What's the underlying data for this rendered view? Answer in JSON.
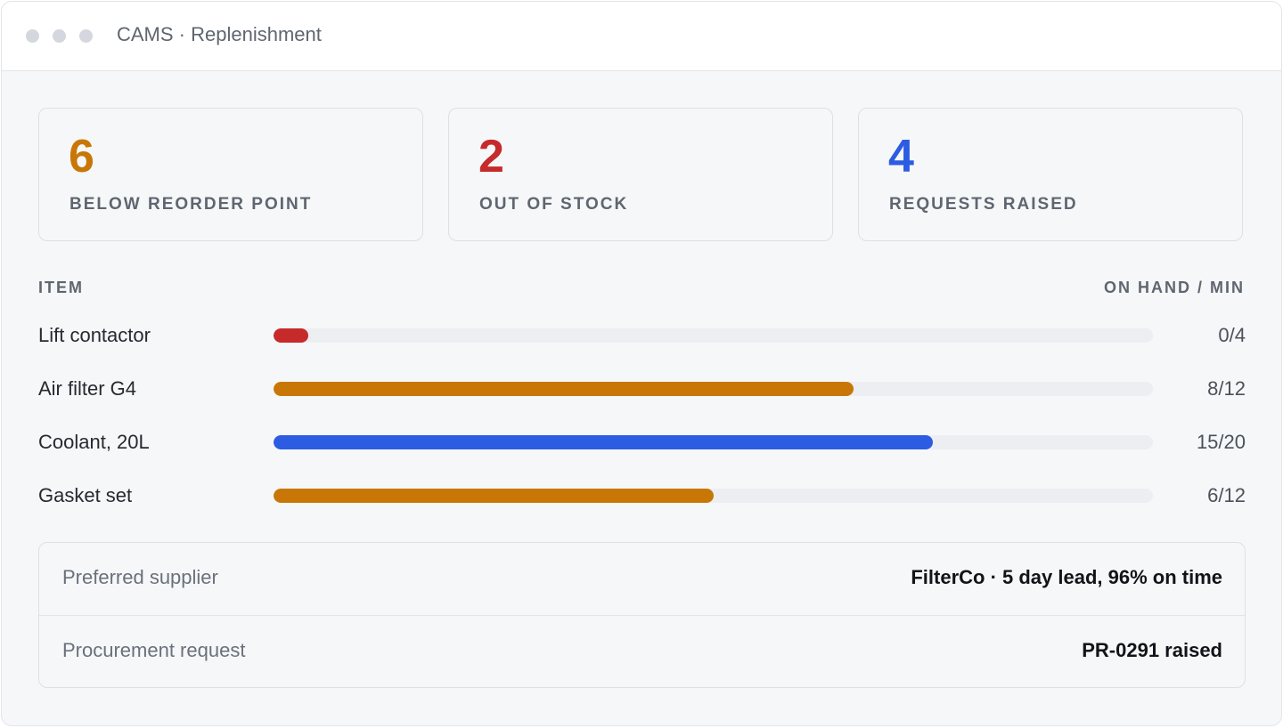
{
  "window": {
    "title": "CAMS · Replenishment"
  },
  "stats": [
    {
      "value": "6",
      "label": "BELOW REORDER POINT",
      "color": "#c87707"
    },
    {
      "value": "2",
      "label": "OUT OF STOCK",
      "color": "#c62a2a"
    },
    {
      "value": "4",
      "label": "REQUESTS RAISED",
      "color": "#2c5ce2"
    }
  ],
  "table": {
    "item_header": "ITEM",
    "qty_header": "ON HAND / MIN",
    "rows": [
      {
        "name": "Lift contactor",
        "on_hand": 0,
        "min": 4,
        "display": "0/4",
        "level": 0.04,
        "color": "#c62a2a"
      },
      {
        "name": "Air filter G4",
        "on_hand": 8,
        "min": 12,
        "display": "8/12",
        "level": 0.66,
        "color": "#c87707"
      },
      {
        "name": "Coolant, 20L",
        "on_hand": 15,
        "min": 20,
        "display": "15/20",
        "level": 0.75,
        "color": "#2c5ce2"
      },
      {
        "name": "Gasket set",
        "on_hand": 6,
        "min": 12,
        "display": "6/12",
        "level": 0.5,
        "color": "#c87707"
      }
    ]
  },
  "details": {
    "supplier_label": "Preferred supplier",
    "supplier_value": "FilterCo · 5 day lead, 96% on time",
    "procurement_label": "Procurement request",
    "procurement_value": "PR-0291 raised"
  }
}
